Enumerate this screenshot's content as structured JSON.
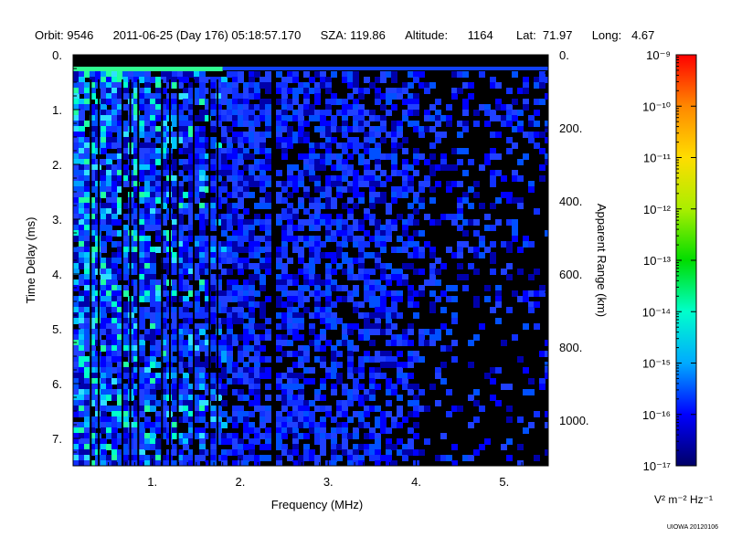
{
  "header": {
    "orbit": "Orbit: 9546",
    "date": "2011-06-25 (Day 176) 05:18:57.170",
    "sza": "SZA: 119.86",
    "altitude": "Altitude:      1164",
    "lat": "Lat:  71.97",
    "long": "Long:   4.67"
  },
  "credit": "UIOWA 20120106",
  "chart_data": {
    "type": "heatmap",
    "title": "",
    "xlabel": "Frequency (MHz)",
    "ylabel": "Time Delay (ms)",
    "y2label": "Apparent Range (km)",
    "xlim": [
      0.1,
      5.5
    ],
    "ylim": [
      7.5,
      0.0
    ],
    "x_ticks": [
      1,
      2,
      3,
      4,
      5
    ],
    "x_tick_labels": [
      "1.",
      "2.",
      "3.",
      "4.",
      "5."
    ],
    "y_ticks": [
      0,
      1,
      2,
      3,
      4,
      5,
      6,
      7
    ],
    "y_tick_labels": [
      "0.",
      "1.",
      "2.",
      "3.",
      "4.",
      "5.",
      "6.",
      "7."
    ],
    "y2_ticks_ms": [
      0.0,
      1.3333,
      2.6667,
      4.0,
      5.3333,
      6.6667
    ],
    "y2_tick_labels": [
      "0.",
      "200.",
      "400.",
      "600.",
      "800.",
      "1000."
    ],
    "colorbar": {
      "label": "V² m⁻² Hz⁻¹",
      "scale": "log",
      "range": [
        1e-17,
        1e-09
      ],
      "tick_exponents": [
        -9,
        -10,
        -11,
        -12,
        -13,
        -14,
        -15,
        -16,
        -17
      ],
      "tick_labels": [
        "10⁻⁹",
        "10⁻¹⁰",
        "10⁻¹¹",
        "10⁻¹²",
        "10⁻¹³",
        "10⁻¹⁴",
        "10⁻¹⁵",
        "10⁻¹⁶",
        "10⁻¹⁷"
      ],
      "colors": [
        "#000066",
        "#0000ff",
        "#00aaff",
        "#00ffcc",
        "#00dd00",
        "#aaee00",
        "#ffdd00",
        "#ff8800",
        "#ff0000"
      ]
    },
    "features": {
      "ground_echo_delay_ms": 0.25,
      "strong_band_mhz": [
        0.1,
        1.8
      ],
      "dark_gap_mhz": [
        2.33,
        2.4
      ]
    }
  }
}
